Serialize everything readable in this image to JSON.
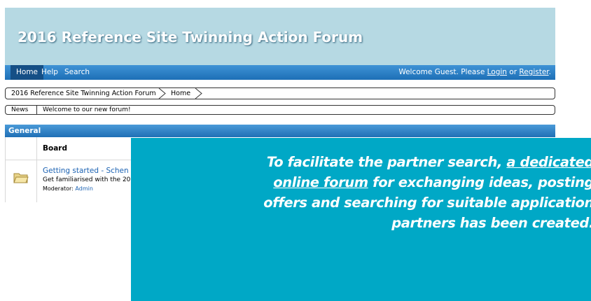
{
  "header": {
    "title": "2016 Reference Site Twinning Action Forum"
  },
  "nav": {
    "items": [
      "Home",
      "Help",
      "Search"
    ],
    "welcome_prefix": "Welcome Guest. Please ",
    "login_label": "Login",
    "or_text": " or ",
    "register_label": "Register",
    "welcome_suffix": "."
  },
  "breadcrumb": {
    "items": [
      "2016 Reference Site Twinning Action Forum",
      "Home"
    ]
  },
  "news": {
    "label": "News",
    "text": "Welcome to our new forum!"
  },
  "category": {
    "title": "General",
    "column_header": "Board",
    "boards": [
      {
        "name": "Getting started - Schen",
        "description": "Get familiarised with the 20",
        "moderator_label": "Moderator: ",
        "moderator_name": "Admin"
      }
    ]
  },
  "overlay": {
    "text_1": "To facilitate the partner search, ",
    "link_1": "a dedicated",
    "link_2": "online forum",
    "text_2": " for exchanging ideas, posting",
    "text_3": "offers and searching for suitable application",
    "text_4": "partners has been created."
  },
  "colors": {
    "header_bg": "#b6d9e3",
    "nav_bg": "#1d6fb6",
    "overlay_bg": "#00a8c6",
    "link": "#1d63b3"
  }
}
